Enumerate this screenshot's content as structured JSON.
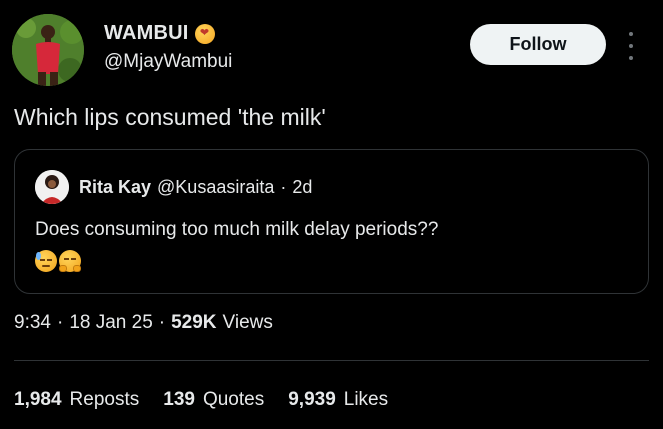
{
  "author": {
    "display_name": "WAMBUI",
    "handle": "@MjayWambui",
    "name_emoji": "face-blowing-kiss-icon"
  },
  "follow_button": {
    "label": "Follow"
  },
  "tweet": {
    "text": "Which lips consumed 'the milk'"
  },
  "quote": {
    "display_name": "Rita Kay",
    "handle": "@Kusaasiraita",
    "separator": "·",
    "time": "2d",
    "text": "Does consuming too much milk delay periods??",
    "emojis": [
      "downcast-face-with-sweat-icon",
      "hugging-face-icon"
    ]
  },
  "meta": {
    "time": "9:34",
    "sep1": "·",
    "date": "18 Jan 25",
    "sep2": "·",
    "views_count": "529K",
    "views_label": "Views"
  },
  "stats": {
    "reposts": {
      "count": "1,984",
      "label": "Reposts"
    },
    "quotes": {
      "count": "139",
      "label": "Quotes"
    },
    "likes": {
      "count": "9,939",
      "label": "Likes"
    }
  },
  "colors": {
    "background": "#000000",
    "text": "#e7e9ea",
    "border": "#2f3336",
    "follow_bg": "#eff3f4",
    "follow_text": "#0f1419"
  }
}
